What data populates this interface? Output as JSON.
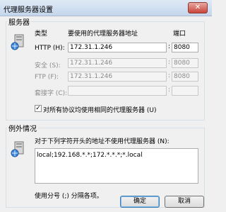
{
  "window": {
    "title": "代理服务器设置",
    "close_glyph": "✕"
  },
  "servers": {
    "group_label": "服务器",
    "headers": {
      "type": "类型",
      "address": "要使用的代理服务器地址",
      "port": "端口"
    },
    "rows": [
      {
        "label": "HTTP (H):",
        "address": "172.31.1.246",
        "port": "8080",
        "enabled": true
      },
      {
        "label": "安全 (S):",
        "address": "172.31.1.246",
        "port": "8080",
        "enabled": false
      },
      {
        "label": "FTP (F):",
        "address": "172.31.1.246",
        "port": "8080",
        "enabled": false
      },
      {
        "label": "套接字 (C):",
        "address": "",
        "port": "",
        "enabled": false
      }
    ],
    "same_proxy_checkbox": {
      "label": "对所有协议均使用相同的代理服务器 (U)",
      "checked": true
    }
  },
  "exceptions": {
    "group_label": "例外情况",
    "instruction": "对于下列字符开头的地址不使用代理服务器 (N):",
    "value": "local;192.168.*.*;172.*.*.*;*.local",
    "hint": "使用分号 (;) 分隔各项。"
  },
  "buttons": {
    "ok": "确定",
    "cancel": "取消"
  },
  "icons": {
    "server": "server-icon"
  }
}
